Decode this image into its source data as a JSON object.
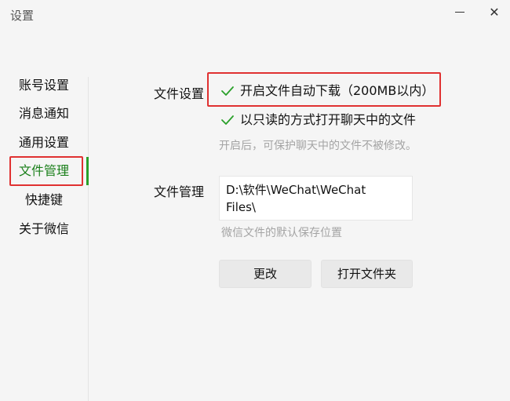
{
  "window": {
    "title": "设置",
    "minimize_icon": "minimize-icon",
    "close_label": "✕"
  },
  "sidebar": {
    "items": [
      {
        "label": "账号设置",
        "active": false
      },
      {
        "label": "消息通知",
        "active": false
      },
      {
        "label": "通用设置",
        "active": false
      },
      {
        "label": "文件管理",
        "active": true
      },
      {
        "label": "快捷键",
        "active": false
      },
      {
        "label": "关于微信",
        "active": false
      }
    ],
    "active_color": "#2aa02a"
  },
  "file_settings": {
    "section_label": "文件设置",
    "auto_download": {
      "label": "开启文件自动下载（200MB以内）",
      "checked": true
    },
    "readonly_open": {
      "label": "以只读的方式打开聊天中的文件",
      "checked": true
    },
    "readonly_hint": "开启后，可保护聊天中的文件不被修改。"
  },
  "file_management": {
    "section_label": "文件管理",
    "path": "D:\\软件\\WeChat\\WeChat\nFiles\\",
    "path_hint": "微信文件的默认保存位置",
    "change_button": "更改",
    "open_folder_button": "打开文件夹"
  },
  "colors": {
    "check": "#2aa02a",
    "highlight_box": "#e03131"
  }
}
